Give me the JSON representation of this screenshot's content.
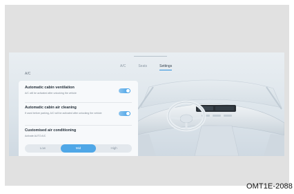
{
  "tabs": [
    {
      "label": "A/C",
      "active": false
    },
    {
      "label": "Seats",
      "active": false
    },
    {
      "label": "Settings",
      "active": true
    }
  ],
  "section_title": "A/C",
  "settings": {
    "ventilation": {
      "title": "Automatic cabin ventilation",
      "description": "A/C will be activated after unlocking the vehicle",
      "enabled": true
    },
    "cleaning": {
      "title": "Automatic cabin air cleaning",
      "description": "If used before parking, A/C will be activated after unlocking the vehicle",
      "enabled": true
    },
    "custom": {
      "title": "Customised air conditioning",
      "description": "Activate AUTO A/C",
      "options": [
        "Low",
        "Mid",
        "High"
      ],
      "selected": "Mid"
    }
  },
  "caption": "OMT1E-2088",
  "colors": {
    "accent": "#4fa7e7",
    "tab_underline": "#2b8fdc",
    "screen_bg": "#dde5eb",
    "panel_bg": "#f7f9fb"
  }
}
